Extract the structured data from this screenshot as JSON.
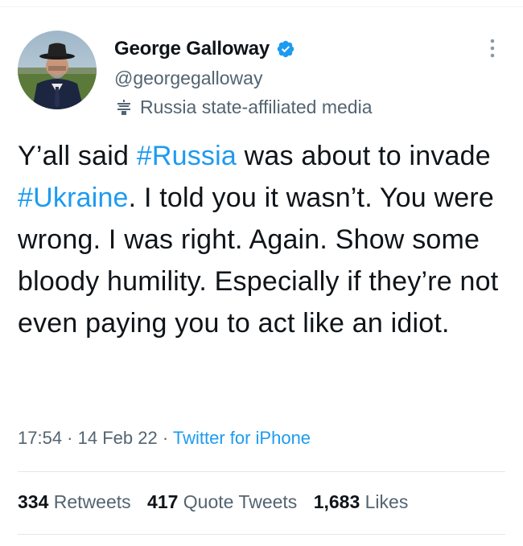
{
  "author": {
    "name": "George Galloway",
    "handle": "@georgegalloway",
    "label": "Russia state-affiliated media"
  },
  "tweet": {
    "parts": [
      {
        "text": "Y’all said ",
        "type": "text"
      },
      {
        "text": "#Russia",
        "type": "hashtag"
      },
      {
        "text": " was about to invade ",
        "type": "text"
      },
      {
        "text": "#Ukraine",
        "type": "hashtag"
      },
      {
        "text": ". I told you it wasn’t. You were wrong. I was right. Again. Show some bloody humility. Especially if they’re not even paying you to act like an idiot.",
        "type": "text"
      }
    ]
  },
  "meta": {
    "time": "17:54",
    "sep1": " · ",
    "date": "14 Feb 22",
    "sep2": " · ",
    "source": "Twitter for iPhone"
  },
  "stats": {
    "retweets_count": "334",
    "retweets_label": "Retweets",
    "quotes_count": "417",
    "quotes_label": "Quote Tweets",
    "likes_count": "1,683",
    "likes_label": "Likes"
  },
  "colors": {
    "link": "#1d9bf0",
    "secondary_text": "#536471",
    "primary_text": "#0f1419"
  },
  "icons": {
    "verified": "verified-badge-icon",
    "state_media": "podium-icon",
    "more": "more-vertical-icon"
  }
}
